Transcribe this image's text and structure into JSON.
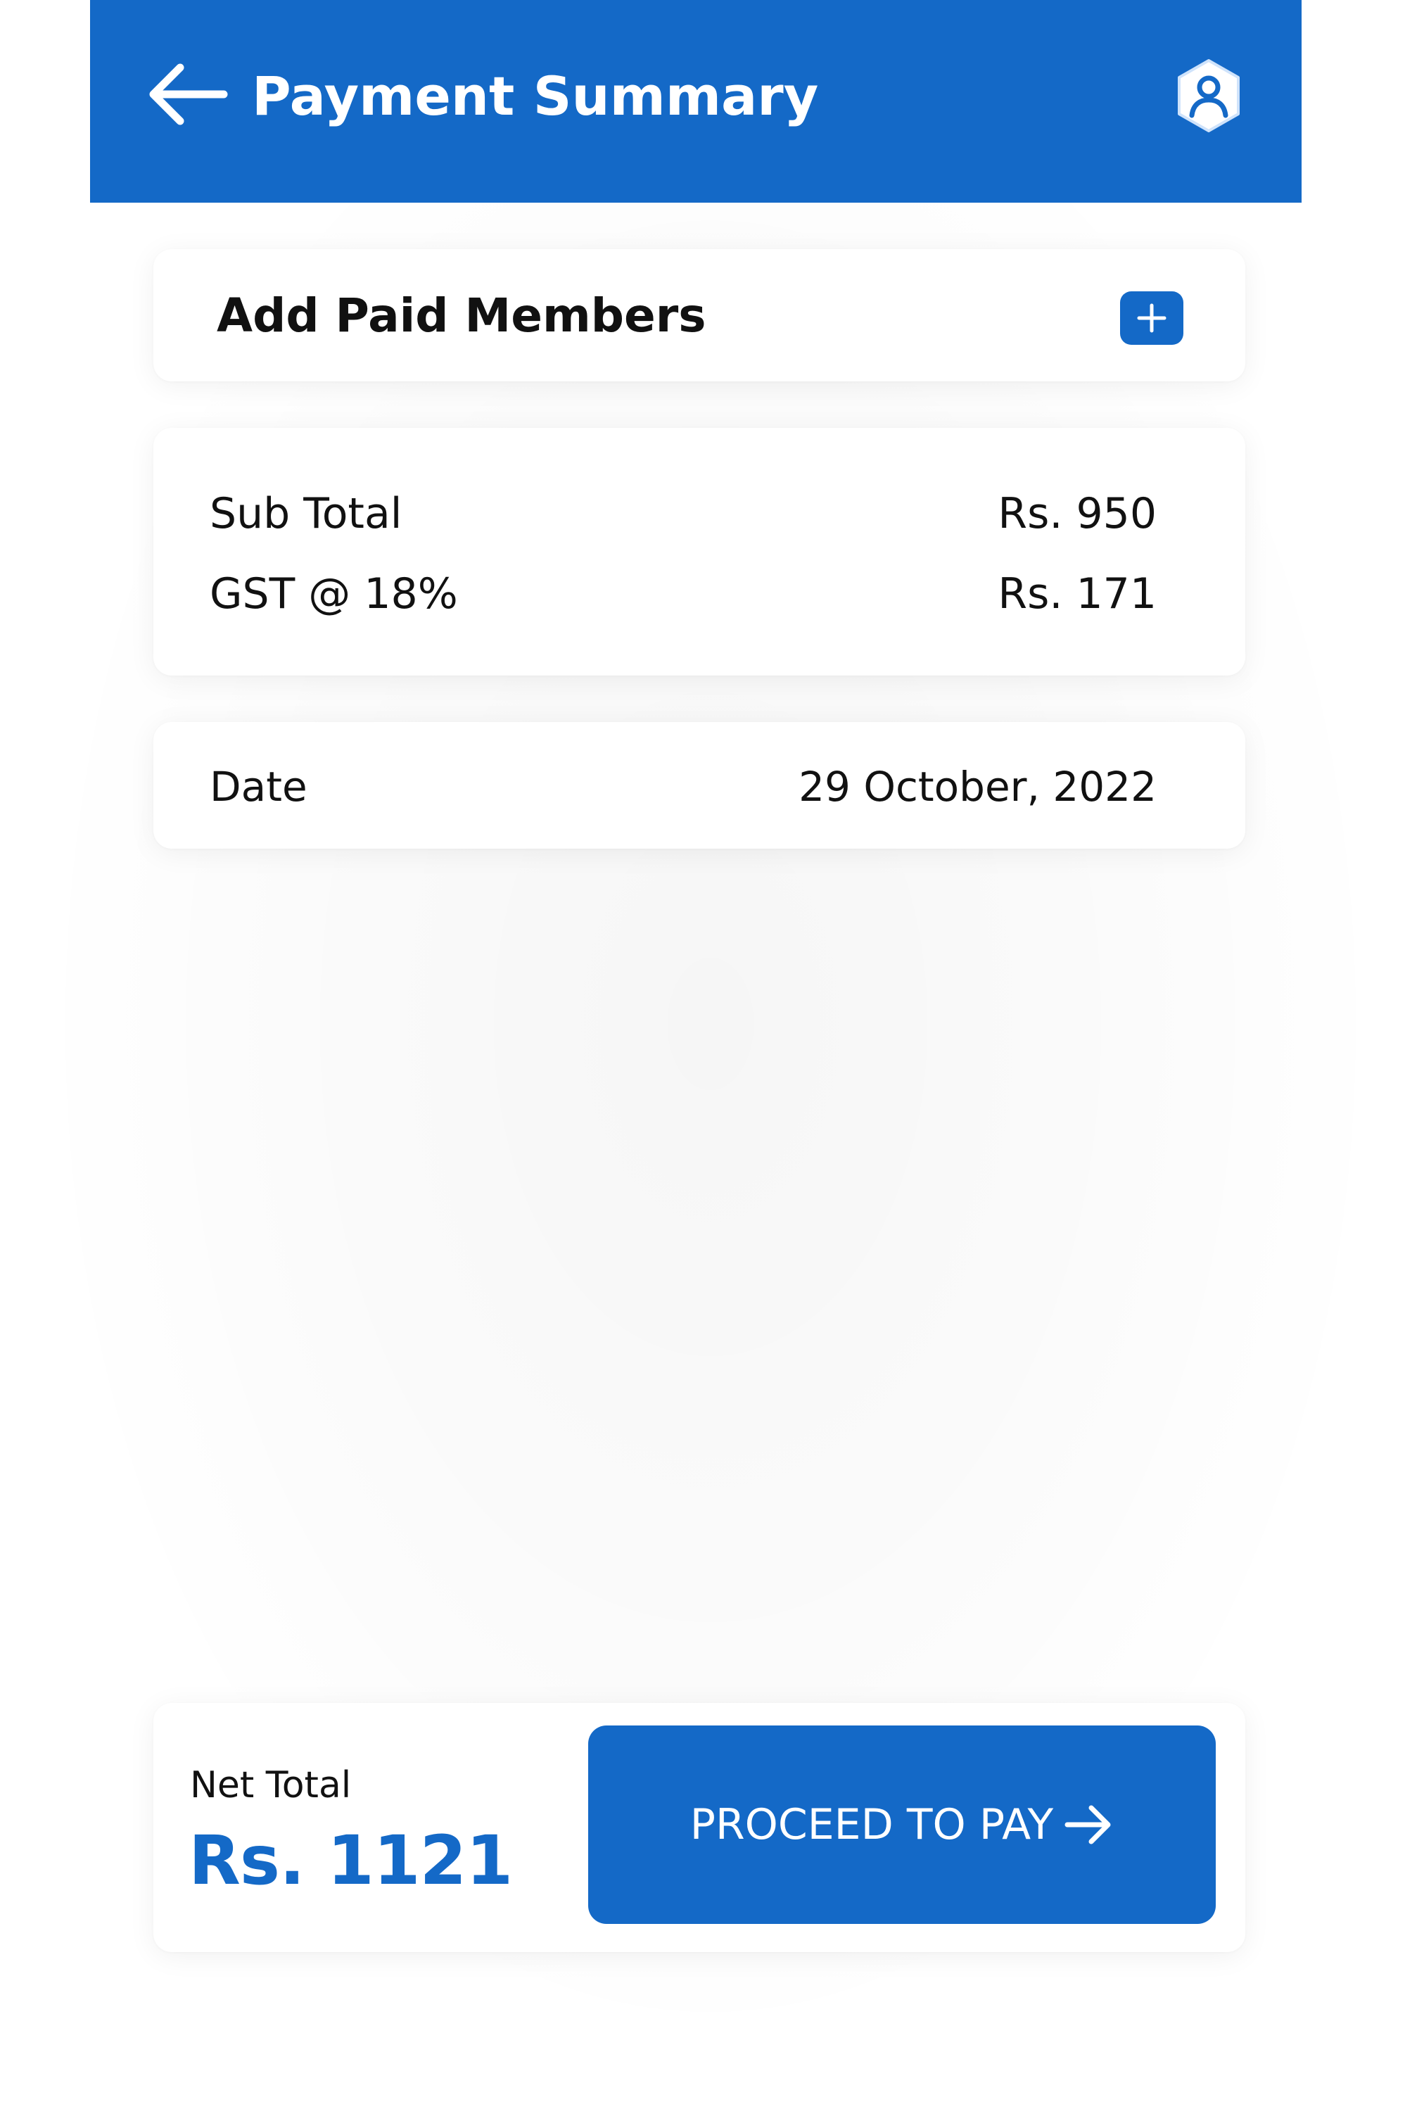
{
  "colors": {
    "primary": "#1469c7",
    "text": "#111111",
    "background": "#ffffff"
  },
  "header": {
    "title": "Payment Summary",
    "back_icon": "arrow-left-icon",
    "profile_icon": "user-hexagon-icon"
  },
  "members": {
    "label": "Add Paid Members",
    "add_icon": "plus-icon"
  },
  "totals": {
    "rows": [
      {
        "label": "Sub Total",
        "value": "Rs. 950"
      },
      {
        "label": "GST @ 18%",
        "value": "Rs. 171"
      }
    ]
  },
  "date": {
    "label": "Date",
    "value": "29 October, 2022"
  },
  "footer": {
    "net_label": "Net Total",
    "net_value": "Rs. 1121",
    "pay_label": "PROCEED TO PAY",
    "pay_icon": "arrow-right-icon"
  }
}
